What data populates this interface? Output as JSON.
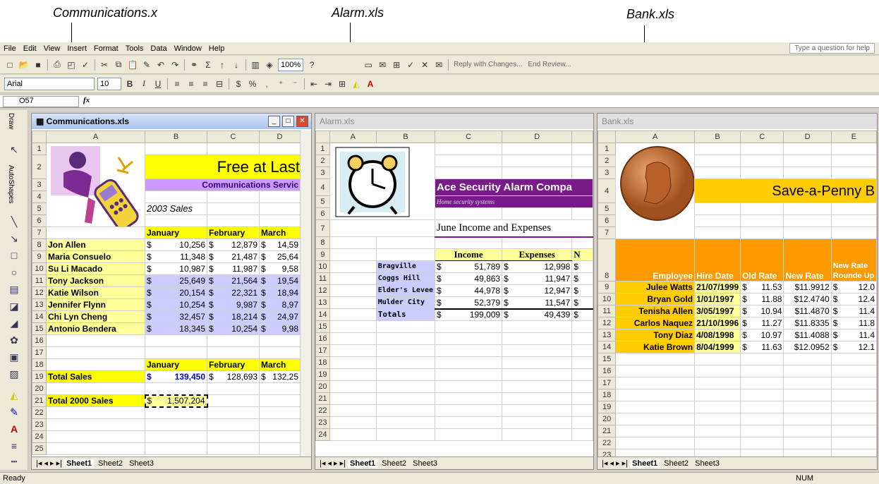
{
  "callouts": {
    "communications": "Communications.x",
    "alarm": "Alarm.xls",
    "bank": "Bank.xls"
  },
  "menu": [
    "File",
    "Edit",
    "View",
    "Insert",
    "Format",
    "Tools",
    "Data",
    "Window",
    "Help"
  ],
  "help_box": "Type a question for help",
  "toolbar": {
    "zoom": "100%",
    "review_label": "Reply with Changes...",
    "end_review": "End Review..."
  },
  "format": {
    "font": "Arial",
    "size": "10"
  },
  "formula": {
    "name_box": "O57",
    "fx": "fx"
  },
  "draw": {
    "draw_label": "Draw",
    "autoshapes_label": "AutoShapes"
  },
  "status": {
    "left": "Ready",
    "num": "NUM"
  },
  "comm": {
    "title": "Communications.xls",
    "cols": [
      "A",
      "B",
      "C",
      "D"
    ],
    "banner": "Free at Last",
    "subtitle": "Communications Servic",
    "sales_label": "2003 Sales",
    "months": [
      "January",
      "February",
      "March"
    ],
    "rows": [
      {
        "n": "8",
        "name": "Jon Allen",
        "v": [
          "10,256",
          "12,879",
          "14,59"
        ]
      },
      {
        "n": "9",
        "name": "Maria Consuelo",
        "v": [
          "11,348",
          "21,487",
          "25,64"
        ]
      },
      {
        "n": "10",
        "name": "Su Li Macado",
        "v": [
          "10,987",
          "11,987",
          "9,58"
        ]
      },
      {
        "n": "11",
        "name": "Tony Jackson",
        "v": [
          "25,649",
          "21,564",
          "19,54"
        ]
      },
      {
        "n": "12",
        "name": "Katie Wilson",
        "v": [
          "20,154",
          "22,321",
          "18,94"
        ]
      },
      {
        "n": "13",
        "name": "Jennifer Flynn",
        "v": [
          "10,254",
          "9,987",
          "8,97"
        ]
      },
      {
        "n": "14",
        "name": "Chi Lyn Cheng",
        "v": [
          "32,457",
          "18,214",
          "24,97"
        ]
      },
      {
        "n": "15",
        "name": "Antonio Bendera",
        "v": [
          "18,345",
          "10,254",
          "9,98"
        ]
      }
    ],
    "total_sales_label": "Total Sales",
    "total_sales": [
      "139,450",
      "128,693",
      "132,25"
    ],
    "total_2000_label": "Total 2000 Sales",
    "total_2000": "1,507,204",
    "tabs": [
      "Sheet1",
      "Sheet2",
      "Sheet3"
    ]
  },
  "alarm": {
    "title": "Alarm.xls",
    "cols": [
      "A",
      "B",
      "C",
      "D"
    ],
    "company": "Ace Security Alarm Compa",
    "tagline": "Home security systems",
    "heading": "June Income and Expenses",
    "headers": [
      "Income",
      "Expenses",
      "N"
    ],
    "rows": [
      {
        "n": "10",
        "name": "Bragville",
        "v": [
          "51,789",
          "12,998"
        ]
      },
      {
        "n": "11",
        "name": "Coggs Hill",
        "v": [
          "49,863",
          "11,947"
        ]
      },
      {
        "n": "12",
        "name": "Elder's Levee",
        "v": [
          "44,978",
          "12,947"
        ]
      },
      {
        "n": "13",
        "name": "Mulder City",
        "v": [
          "52,379",
          "11,547"
        ]
      }
    ],
    "totals_label": "Totals",
    "totals": [
      "199,009",
      "49,439"
    ],
    "tabs": [
      "Sheet1",
      "Sheet2",
      "Sheet3"
    ]
  },
  "bank": {
    "title": "Bank.xls",
    "cols": [
      "A",
      "B",
      "C",
      "D",
      "E"
    ],
    "banner": "Save-a-Penny B",
    "headers": [
      "Employee",
      "Hire Date",
      "Old Rate",
      "New Rate",
      "New Rate Rounde Up"
    ],
    "rows": [
      {
        "n": "9",
        "name": "Julee Watts",
        "date": "21/07/1999",
        "old": "11.53",
        "new": "$11.9912",
        "up": "12.0"
      },
      {
        "n": "10",
        "name": "Bryan Gold",
        "date": "1/01/1997",
        "old": "11.88",
        "new": "$12.4740",
        "up": "12.4"
      },
      {
        "n": "11",
        "name": "Tenisha Allen",
        "date": "3/05/1997",
        "old": "10.94",
        "new": "$11.4870",
        "up": "11.4"
      },
      {
        "n": "12",
        "name": "Carlos Naquez",
        "date": "21/10/1996",
        "old": "11.27",
        "new": "$11.8335",
        "up": "11.8"
      },
      {
        "n": "13",
        "name": "Tony Diaz",
        "date": "4/08/1998",
        "old": "10.97",
        "new": "$11.4088",
        "up": "11.4"
      },
      {
        "n": "14",
        "name": "Katie Brown",
        "date": "8/04/1999",
        "old": "11.63",
        "new": "$12.0952",
        "up": "12.1"
      }
    ],
    "tabs": [
      "Sheet1",
      "Sheet2",
      "Sheet3"
    ]
  },
  "currency": "$"
}
